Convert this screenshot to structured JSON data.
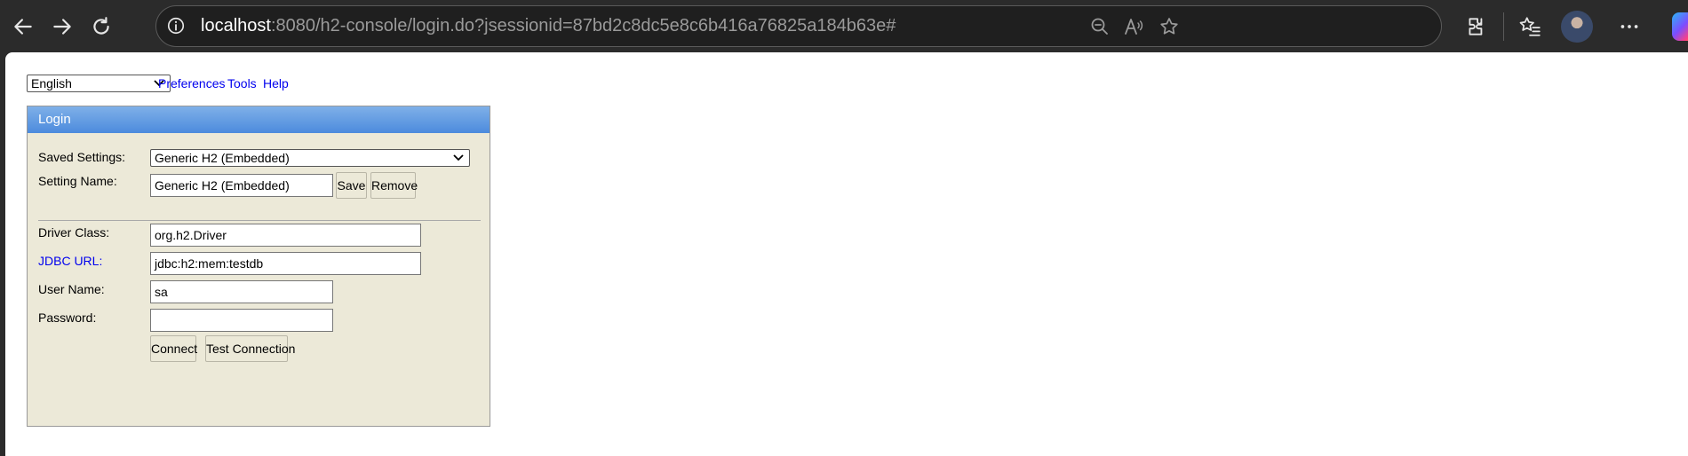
{
  "browser": {
    "url_host": "localhost",
    "url_rest": ":8080/h2-console/login.do?jsessionid=87bd2c8dc5e8c6b416a76825a184b63e#",
    "icons": [
      "back-icon",
      "forward-icon",
      "refresh-icon",
      "info-icon",
      "zoom-out-icon",
      "read-aloud-icon",
      "favorite-star-icon",
      "extensions-icon",
      "favorites-icon",
      "profile-avatar",
      "more-icon",
      "copilot-icon"
    ]
  },
  "topbar": {
    "language": "English",
    "preferences": "Preferences",
    "tools": "Tools",
    "help": "Help"
  },
  "login": {
    "title": "Login",
    "saved_settings_label": "Saved Settings:",
    "saved_settings_value": "Generic H2 (Embedded)",
    "setting_name_label": "Setting Name:",
    "setting_name_value": "Generic H2 (Embedded)",
    "save_label": "Save",
    "remove_label": "Remove",
    "driver_class_label": "Driver Class:",
    "driver_class_value": "org.h2.Driver",
    "jdbc_url_label": "JDBC URL:",
    "jdbc_url_value": "jdbc:h2:mem:testdb",
    "user_name_label": "User Name:",
    "user_name_value": "sa",
    "password_label": "Password:",
    "password_value": "",
    "connect_label": "Connect",
    "test_connection_label": "Test Connection"
  },
  "colors": {
    "panel_bg": "#ece9d8",
    "header_gradient_top": "#7fb0e8",
    "header_gradient_bottom": "#4c8bdd",
    "link": "#0000ee",
    "chrome_bg": "#2b2b2b"
  }
}
